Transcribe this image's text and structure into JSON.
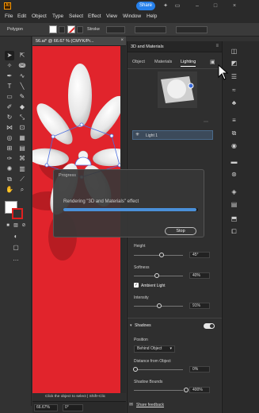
{
  "app": {
    "logo": "Ai"
  },
  "menubar": {
    "items": [
      "File",
      "Edit",
      "Object",
      "Type",
      "Select",
      "Effect",
      "View",
      "Window",
      "Help"
    ],
    "share_label": "Share"
  },
  "controlbar": {
    "shape_label": "Polygon",
    "stroke_label": "Stroke"
  },
  "document": {
    "tab_title": "56.ai* @ 66.67 % (CMYK/Pr...",
    "close": "×"
  },
  "status": {
    "hint": "Click the object to select  |  Shift+Clic",
    "zoom": "66.67%",
    "rotation": "0°"
  },
  "panel": {
    "title": "3D and Materials",
    "tabs": [
      "Object",
      "Materials",
      "Lighting"
    ],
    "active_tab": "Lighting",
    "light_name": "Light 1",
    "height_label": "Height",
    "height_value": "45°",
    "softness_label": "Softness",
    "softness_value": "40%",
    "ambient_label": "Ambient Light",
    "intensity_label": "Intensity",
    "intensity_value": "91%",
    "shadows_label": "Shadows",
    "position_label": "Position",
    "position_value": "Behind Object",
    "distance_label": "Distance from Object",
    "distance_value": "0%",
    "bounds_label": "Shadow Bounds",
    "bounds_value": "400%",
    "feedback_label": "Share feedback",
    "sliders": {
      "height": 0.45,
      "softness": 0.4,
      "intensity": 0.91,
      "distance": 0.0,
      "bounds": 1.0
    }
  },
  "dialog": {
    "title": "Progress",
    "message": "Rendering \"3D and Materials\" effect",
    "progress": 0.99,
    "stop_label": "Stop"
  },
  "colors": {
    "artboard": "#e1242c",
    "accent": "#2680eb",
    "progress": "#4a90d9"
  }
}
